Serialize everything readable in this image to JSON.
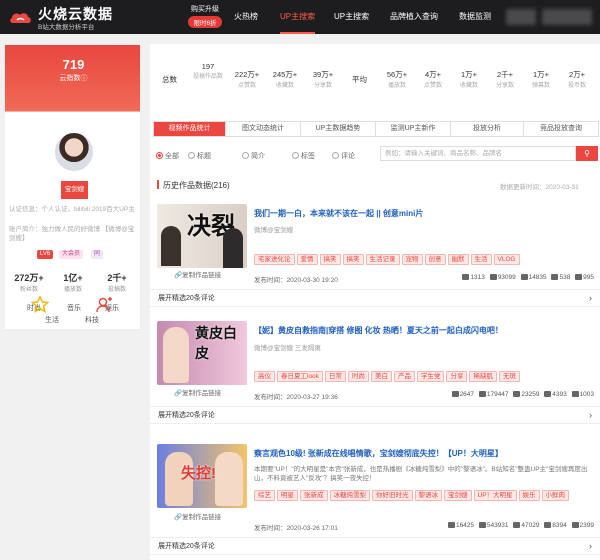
{
  "brand": {
    "title": "火烧云数据",
    "subtitle": "B站大数据分析平台"
  },
  "topbar": {
    "upgrade_label": "购买升级",
    "upgrade_badge": "限时6折",
    "nav": [
      "火热榜",
      "UP主搜索",
      "UP主搜索",
      "品牌植入查询",
      "数据监测"
    ]
  },
  "profile": {
    "followers": "719",
    "followers_label": "云指数ⓘ",
    "name_badge": "宝剑嫂",
    "cert_text": "认证信息：个人认证，bilibili 2019百大UP主",
    "account_text": "账户简介：独力做人民的好微博 【微博@宝剑嫂】",
    "badges": [
      "LV6",
      "大会员",
      "同"
    ],
    "stats": [
      {
        "value": "272万+",
        "label": "粉丝数"
      },
      {
        "value": "1亿+",
        "label": "播放数"
      },
      {
        "value": "2千+",
        "label": "投稿数"
      }
    ],
    "categories": [
      "时尚",
      "音乐",
      "娱乐",
      "生活",
      "科技"
    ],
    "accent": "#e9473f"
  },
  "summary": [
    {
      "value": "197",
      "label": "投稿作品数"
    },
    {
      "value": "222万+",
      "label": "点赞数"
    },
    {
      "value": "245万+",
      "label": "收藏数"
    },
    {
      "value": "39万+",
      "label": "分享数"
    },
    {
      "value": "56万+",
      "label": "播放数"
    },
    {
      "value": "4万+",
      "label": "点赞数"
    },
    {
      "value": "1万+",
      "label": "收藏数"
    },
    {
      "value": "2千+",
      "label": "分享数"
    },
    {
      "value": "1万+",
      "label": "弹幕数"
    },
    {
      "value": "2万+",
      "label": "投币数"
    }
  ],
  "summary_left_label": "总数",
  "summary_right_label": "平均",
  "tabs": [
    "视频作品统计",
    "图文动态统计",
    "UP主数据趋势",
    "监测UP主新作",
    "投放分析",
    "竞品投放查询"
  ],
  "filters": [
    "全部",
    "标题",
    "简介",
    "标签",
    "评论"
  ],
  "search": {
    "placeholder": "例如：请输入关键词、商品名称、品牌名",
    "button_icon": "search-icon"
  },
  "history": {
    "title": "历史作品数据(216)",
    "updated": "数据更新时间：2020-03-31"
  },
  "copy_label": "复制作品链接",
  "videos": [
    {
      "thumb_text": "决裂",
      "title": "我们一期一白，本来就不该在一起 || 创意mini片",
      "author": "微博@宝剑嫂",
      "tags": [
        "宅家进化论",
        "爱情",
        "搞笑",
        "搞笑",
        "生活记录",
        "宠物",
        "创意",
        "幽默",
        "生活",
        "VLOG"
      ],
      "published": "发布时间：2020-03-30 19:20",
      "metrics": [
        "1313",
        "93099",
        "14835",
        "538",
        "995"
      ],
      "expand": "展开精选20条评论"
    },
    {
      "thumb_text": "黄皮白皮",
      "title": "【妮】黄皮自救指南|穿搭 修图 化妆 热晒！夏天之前一起白成闪电吧！",
      "author": "微博@宝剑嫂 三发隔离",
      "tags": [
        "高仪",
        "春日夏工look",
        "日常",
        "时尚",
        "美白",
        "产品",
        "学生党",
        "分享",
        "稀缺肌",
        "无斑"
      ],
      "published": "发布时间：2020-03-27 19:36",
      "metrics": [
        "2647",
        "179447",
        "23259",
        "4393",
        "1003"
      ],
      "expand": "展开精选20条评论"
    },
    {
      "thumb_text": "失控!",
      "title": "察言观色10级! 张新成在线唱情歌，宝剑嫂彻底失控！【UP！大明星】",
      "author": "",
      "desc": "本期要\"UP！\"的大明星是\"本宫\"张新成，也是热播剧《冰糖炖雪梨》中的\"黎语冰\"。B站知名\"整蛊UP主\"宝剑嫂再度出山，不料竟被艺人\"反攻\"？搞笑一夜失控！",
      "tags": [
        "综艺",
        "明星",
        "张新成",
        "冰糖炖雪梨",
        "你好旧时光",
        "黎语冰",
        "宝剑嫂",
        "UP！大明星",
        "娱乐",
        "小鲜肉"
      ],
      "published": "发布时间：2020-03-26 17:01",
      "metrics": [
        "16425",
        "543931",
        "47029",
        "8394",
        "2399"
      ],
      "expand": "展开精选20条评论"
    }
  ]
}
